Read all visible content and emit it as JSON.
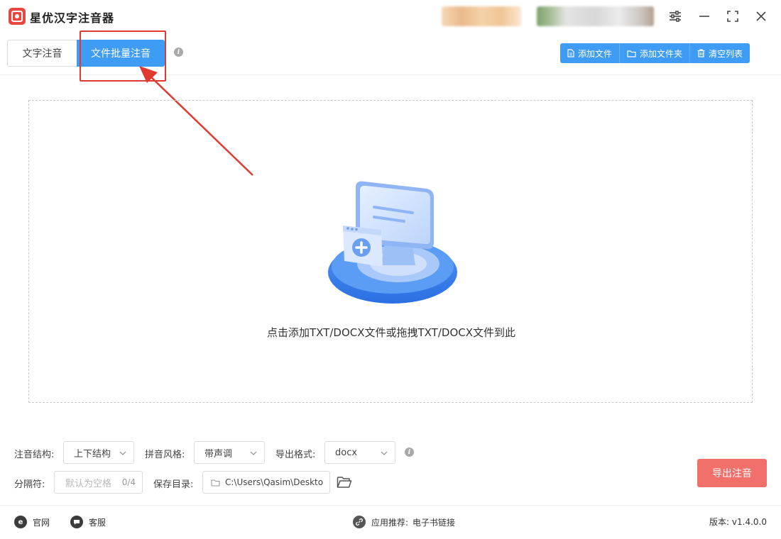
{
  "app": {
    "title": "星优汉字注音器"
  },
  "tabs": [
    {
      "label": "文字注音"
    },
    {
      "label": "文件批量注音"
    }
  ],
  "toolbar": {
    "add_file": "添加文件",
    "add_folder": "添加文件夹",
    "clear_list": "清空列表"
  },
  "dropzone": {
    "hint": "点击添加TXT/DOCX文件或拖拽TXT/DOCX文件到此"
  },
  "options": {
    "structure_label": "注音结构:",
    "structure_value": "上下结构",
    "pinyin_label": "拼音风格:",
    "pinyin_value": "带声调",
    "format_label": "导出格式:",
    "format_value": "docx",
    "separator_label": "分隔符:",
    "separator_placeholder": "默认为空格",
    "separator_count": "0/4",
    "save_label": "保存目录:",
    "save_value": "C:\\Users\\Qasim\\Deskto"
  },
  "actions": {
    "export": "导出注音"
  },
  "footer": {
    "official": "官网",
    "service": "客服",
    "recommend_label": "应用推荐:",
    "recommend_link": "电子书链接",
    "version": "版本: v1.4.0.0"
  },
  "colors": {
    "primary": "#3f9cf5",
    "export": "#f2706a",
    "highlight": "#e03a30"
  }
}
